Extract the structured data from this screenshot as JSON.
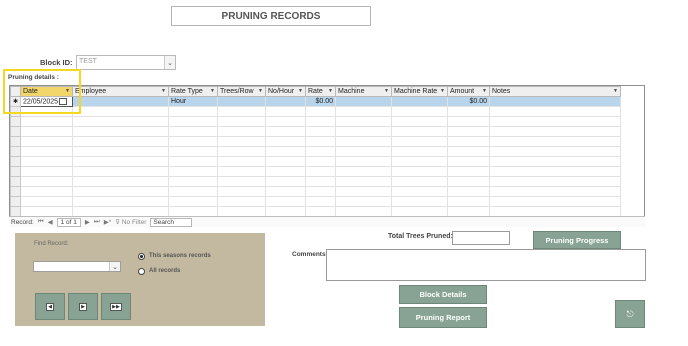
{
  "title": "PRUNING RECORDS",
  "block": {
    "label": "Block ID:",
    "value": "TEST"
  },
  "pruning_label": "Pruning details :",
  "grid": {
    "columns": [
      "Date",
      "Employee",
      "Rate Type",
      "Trees/Row",
      "No/Hour",
      "Rate",
      "Machine",
      "Machine Rate",
      "Amount",
      "Notes"
    ],
    "rows": [
      {
        "date": "22/05/2025",
        "employee": "",
        "rate_type": "Hour",
        "trees_row": "",
        "no_hour": "",
        "rate": "$0.00",
        "machine": "",
        "machine_rate": "",
        "amount": "$0.00",
        "notes": ""
      }
    ]
  },
  "nav": {
    "record_label": "Record:",
    "first": "⏮",
    "prev": "◀",
    "position": "1 of 1",
    "next": "▶",
    "last": "⏭",
    "new": "▶*",
    "no_filter": "No Filter",
    "search": "Search"
  },
  "find": {
    "label": "Find Record:",
    "radio_seasons": "This seasons records",
    "radio_all": "All records",
    "btn_prev": "◀",
    "btn_next": "▶",
    "btn_last": "▶▶"
  },
  "total_trees_label": "Total Trees Pruned:",
  "pruning_progress_button": "Pruning Progress",
  "comments_label": "Comments:",
  "block_details_button": "Block Details",
  "pruning_report_button": "Pruning Report",
  "exit_icon": "exit-door-icon"
}
